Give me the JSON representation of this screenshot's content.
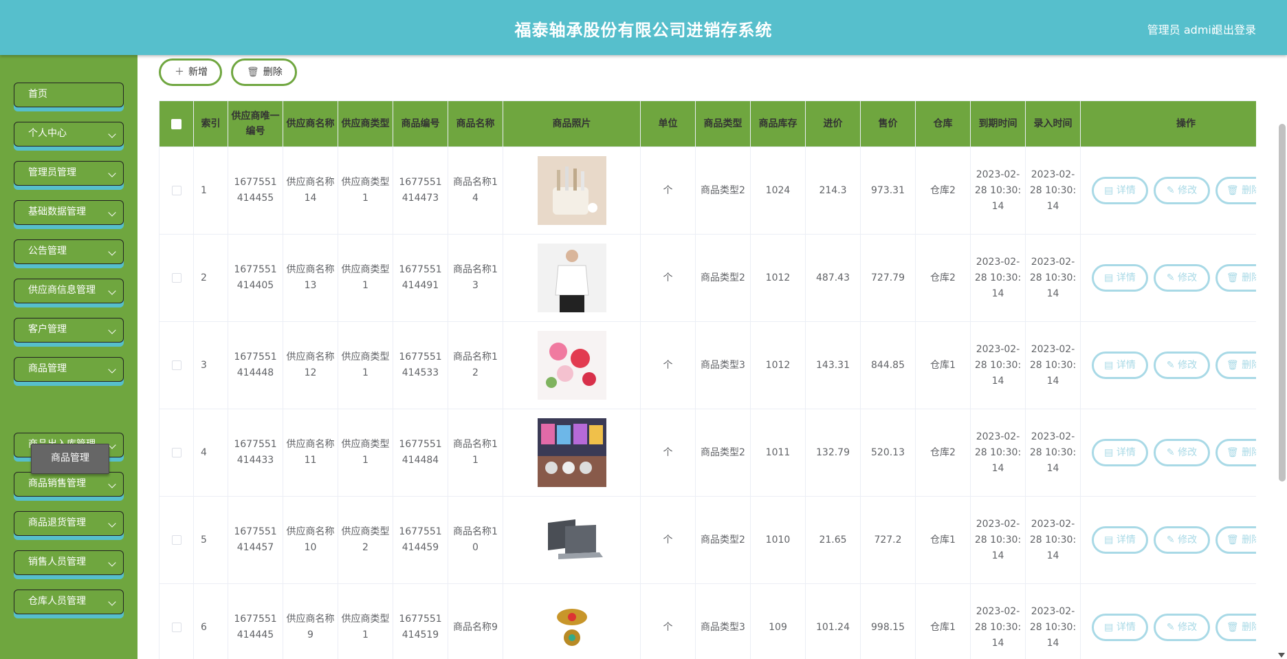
{
  "header": {
    "title": "福泰轴承股份有限公司进销存系统",
    "user": "管理员 admin",
    "logout": "退出登录"
  },
  "sidebar": {
    "items": [
      {
        "label": "首页",
        "chevron": false
      },
      {
        "label": "个人中心",
        "chevron": true
      },
      {
        "label": "管理员管理",
        "chevron": true
      },
      {
        "label": "基础数据管理",
        "chevron": true
      },
      {
        "label": "公告管理",
        "chevron": true
      },
      {
        "label": "供应商信息管理",
        "chevron": true
      },
      {
        "label": "客户管理",
        "chevron": true
      },
      {
        "label": "商品管理",
        "chevron": true
      },
      {
        "label": "商品出入库管理",
        "chevron": true
      },
      {
        "label": "商品销售管理",
        "chevron": true
      },
      {
        "label": "商品退货管理",
        "chevron": true
      },
      {
        "label": "销售人员管理",
        "chevron": true
      },
      {
        "label": "仓库人员管理",
        "chevron": true
      }
    ],
    "submenu_active": "商品管理"
  },
  "toolbar": {
    "add_label": "新增",
    "delete_label": "删除"
  },
  "table": {
    "columns": [
      "索引",
      "供应商唯一编号",
      "供应商名称",
      "供应商类型",
      "商品编号",
      "商品名称",
      "商品照片",
      "单位",
      "商品类型",
      "商品库存",
      "进价",
      "售价",
      "仓库",
      "到期时间",
      "录入时间",
      "操作"
    ],
    "rows": [
      {
        "index": "1",
        "supplier_no": "1677551414455",
        "supplier_name": "供应商名称14",
        "supplier_type": "供应商类型1",
        "goods_no": "1677551414473",
        "goods_name": "商品名称14",
        "photo": "utensil-holder",
        "unit": "个",
        "goods_type": "商品类型2",
        "stock": "1024",
        "cost": "214.3",
        "price": "973.31",
        "warehouse": "仓库2",
        "expire": "2023-02-28 10:30:14",
        "created": "2023-02-28 10:30:14"
      },
      {
        "index": "2",
        "supplier_no": "1677551414405",
        "supplier_name": "供应商名称13",
        "supplier_type": "供应商类型1",
        "goods_no": "1677551414491",
        "goods_name": "商品名称13",
        "photo": "white-shirt",
        "unit": "个",
        "goods_type": "商品类型2",
        "stock": "1012",
        "cost": "487.43",
        "price": "727.79",
        "warehouse": "仓库2",
        "expire": "2023-02-28 10:30:14",
        "created": "2023-02-28 10:30:14"
      },
      {
        "index": "3",
        "supplier_no": "1677551414448",
        "supplier_name": "供应商名称12",
        "supplier_type": "供应商类型1",
        "goods_no": "1677551414533",
        "goods_name": "商品名称12",
        "photo": "flowers",
        "unit": "个",
        "goods_type": "商品类型3",
        "stock": "1012",
        "cost": "143.31",
        "price": "844.85",
        "warehouse": "仓库1",
        "expire": "2023-02-28 10:30:14",
        "created": "2023-02-28 10:30:14"
      },
      {
        "index": "4",
        "supplier_no": "1677551414433",
        "supplier_name": "供应商名称11",
        "supplier_type": "供应商类型1",
        "goods_no": "1677551414484",
        "goods_name": "商品名称11",
        "photo": "plastic-goods",
        "unit": "个",
        "goods_type": "商品类型2",
        "stock": "1011",
        "cost": "132.79",
        "price": "520.13",
        "warehouse": "仓库2",
        "expire": "2023-02-28 10:30:14",
        "created": "2023-02-28 10:30:14"
      },
      {
        "index": "5",
        "supplier_no": "1677551414457",
        "supplier_name": "供应商名称10",
        "supplier_type": "供应商类型2",
        "goods_no": "1677551414459",
        "goods_name": "商品名称10",
        "photo": "laptop",
        "unit": "个",
        "goods_type": "商品类型2",
        "stock": "1010",
        "cost": "21.65",
        "price": "727.2",
        "warehouse": "仓库1",
        "expire": "2023-02-28 10:30:14",
        "created": "2023-02-28 10:30:14"
      },
      {
        "index": "6",
        "supplier_no": "1677551414445",
        "supplier_name": "供应商名称9",
        "supplier_type": "供应商类型1",
        "goods_no": "1677551414519",
        "goods_name": "商品名称9",
        "photo": "brooch",
        "unit": "个",
        "goods_type": "商品类型3",
        "stock": "109",
        "cost": "101.24",
        "price": "998.15",
        "warehouse": "仓库1",
        "expire": "2023-02-28 10:30:14",
        "created": "2023-02-28 10:30:14"
      }
    ],
    "actions": {
      "detail": "详情",
      "edit": "修改",
      "delete": "删除"
    }
  },
  "colors": {
    "header": "#56bfcc",
    "sidebar": "#6fa63f",
    "accent": "#6fa63f",
    "action_border": "#a8d9e6"
  }
}
